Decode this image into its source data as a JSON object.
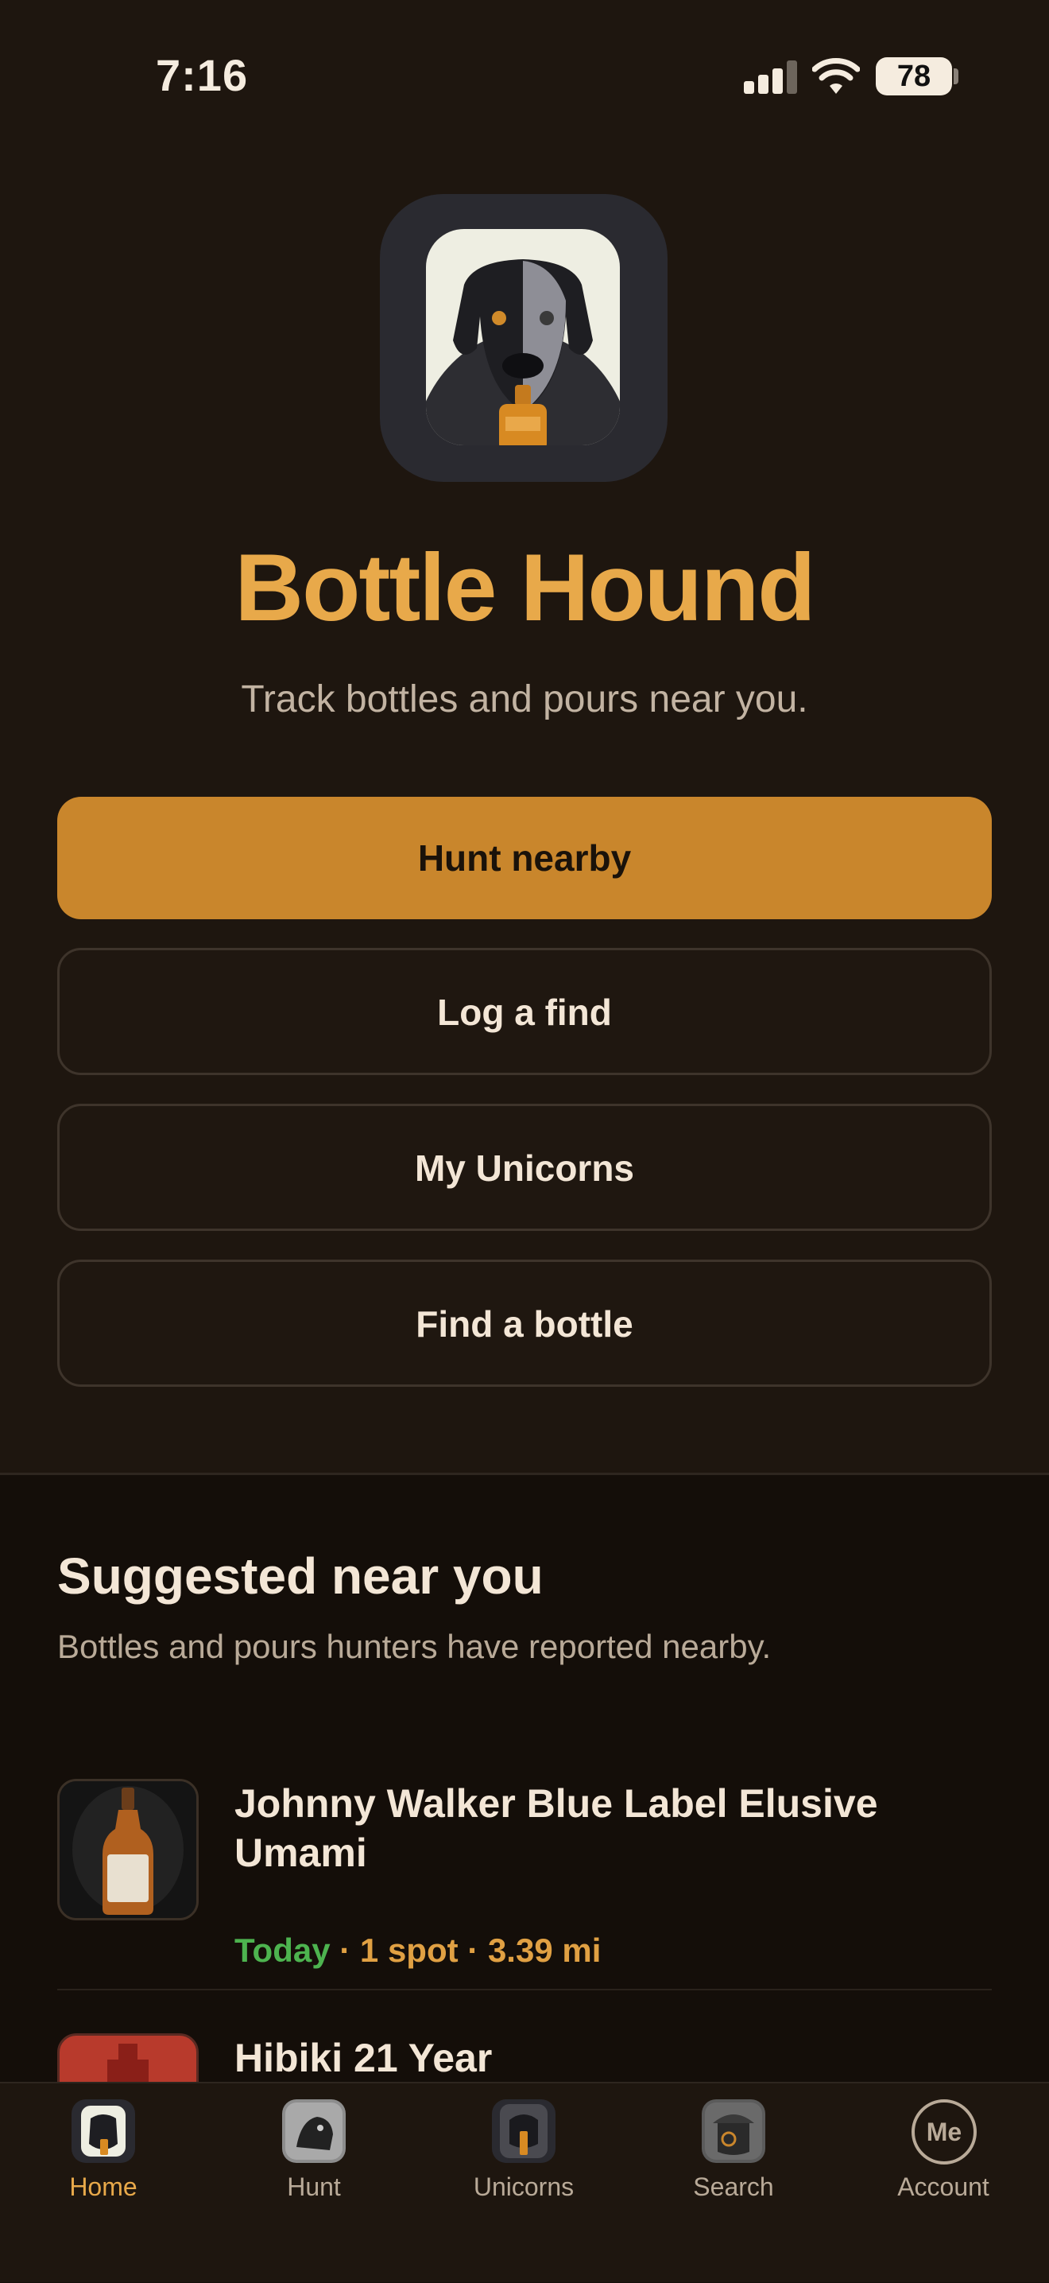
{
  "status_bar": {
    "time": "7:16",
    "battery": "78"
  },
  "hero": {
    "app_name": "Bottle Hound",
    "tagline": "Track bottles and pours near you."
  },
  "actions": {
    "hunt_nearby": "Hunt nearby",
    "log_find": "Log a find",
    "my_unicorns": "My Unicorns",
    "find_bottle": "Find a bottle"
  },
  "suggested": {
    "title": "Suggested near you",
    "subtitle": "Bottles and pours hunters have reported nearby.",
    "items": [
      {
        "name": "Johnny Walker Blue Label Elusive Umami",
        "when": "Today",
        "spots": "1 spot",
        "distance": "3.39 mi",
        "separator": "·"
      },
      {
        "name": "Hibiki 21 Year"
      }
    ]
  },
  "tab_bar": {
    "tabs": [
      {
        "label": "Home",
        "active": true
      },
      {
        "label": "Hunt"
      },
      {
        "label": "Unicorns"
      },
      {
        "label": "Search"
      },
      {
        "label": "Account",
        "badge": "Me"
      }
    ]
  },
  "colors": {
    "accent": "#e8a94a",
    "primary_button": "#c9862c",
    "background": "#1e160f",
    "today": "#4db34f"
  }
}
